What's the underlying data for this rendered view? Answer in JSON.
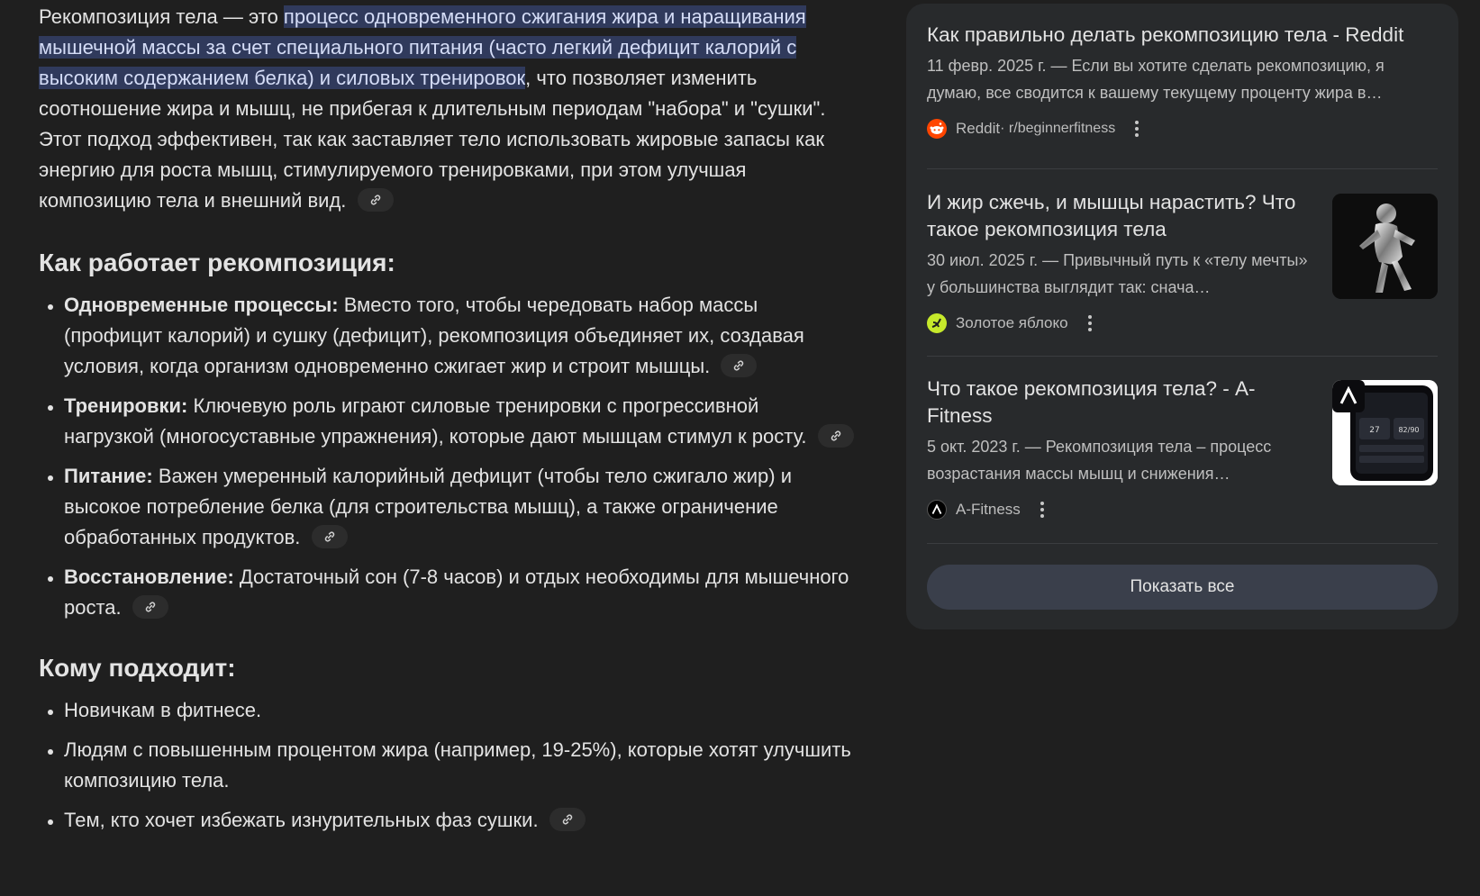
{
  "answer": {
    "intro_prefix": "Рекомпозиция тела — это ",
    "intro_highlight": "процесс одновременного сжигания жира и наращивания мышечной массы за счет специального питания (часто легкий дефицит калорий с высоким содержанием белка) и силовых тренировок",
    "intro_suffix": ", что позволяет изменить соотношение жира и мышц, не прибегая к длительным периодам \"набора\" и \"сушки\". Этот подход эффективен, так как заставляет тело использовать жировые запасы как энергию для роста мышц, стимулируемого тренировками, при этом улучшая композицию тела и внешний вид.",
    "how_heading": "Как работает рекомпозиция:",
    "how_items": [
      {
        "term": "Одновременные процессы:",
        "text": " Вместо того, чтобы чередовать набор массы (профицит калорий) и сушку (дефицит), рекомпозиция объединяет их, создавая условия, когда организм одновременно сжигает жир и строит мышцы."
      },
      {
        "term": "Тренировки:",
        "text": " Ключевую роль играют силовые тренировки с прогрессивной нагрузкой (многосуставные упражнения), которые дают мышцам стимул к росту."
      },
      {
        "term": "Питание:",
        "text": " Важен умеренный калорийный дефицит (чтобы тело сжигало жир) и высокое потребление белка (для строительства мышц), а также ограничение обработанных продуктов."
      },
      {
        "term": "Восстановление:",
        "text": " Достаточный сон (7-8 часов) и отдых необходимы для мышечного роста."
      }
    ],
    "who_heading": "Кому подходит:",
    "who_items": [
      "Новичкам в фитнесе.",
      "Людям с повышенным процентом жира (например, 19-25%), которые хотят улучшить композицию тела.",
      "Тем, кто хочет избежать изнурительных фаз сушки."
    ],
    "link_icon": "link-icon"
  },
  "sources": [
    {
      "title": "Как правильно делать рекомпозицию тела - Reddit",
      "snippet": "11 февр. 2025 г. — Если вы хотите сделать рекомпозицию, я думаю, все сводится к вашему текущему проценту жира в…",
      "site": "Reddit",
      "path": " · r/beginnerfitness",
      "favicon_color": "#ff4500",
      "icon": "reddit-icon"
    },
    {
      "title": "И жир сжечь, и мышцы нарастить? Что такое рекомпозиция тела",
      "snippet": "30 июл. 2025 г. — Привычный путь к «телу мечты» у большинства выглядит так: снача…",
      "site": "Золотое яблоко",
      "favicon_color": "#c6e92b",
      "icon": "goldapple-icon"
    },
    {
      "title": "Что такое рекомпозиция тела? - A-Fitness",
      "snippet": "5 окт. 2023 г. — Рекомпозиция тела – процесс возрастания массы мышц и снижения…",
      "site": "A-Fitness",
      "favicon_color": "#000000",
      "icon": "afitness-icon"
    }
  ],
  "show_all_label": "Показать все",
  "colors": {
    "background": "#1f1f1f",
    "panel": "#282a2c",
    "highlight": "#303a5c",
    "button": "#3a3f4b"
  }
}
